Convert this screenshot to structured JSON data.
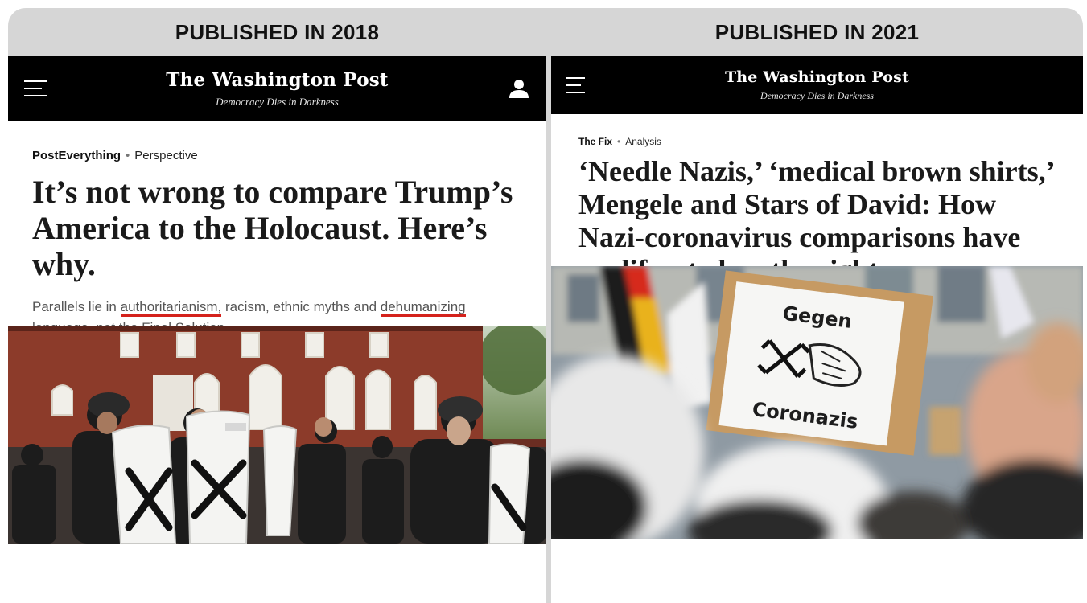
{
  "left": {
    "label": "PUBLISHED IN 2018",
    "masthead": "The Washington Post",
    "tagline": "Democracy Dies in Darkness",
    "section": "PostEverything",
    "category": "Perspective",
    "headline": "It’s not wrong to compare Trump’s America to the Holocaust. Here’s why.",
    "dek": {
      "pre": "Parallels lie in ",
      "u1": "authoritarianism,",
      "mid": " racism, ethnic myths and ",
      "u2": "dehumanizing language,",
      "post": " not the Final Solution"
    }
  },
  "right": {
    "label": "PUBLISHED IN 2021",
    "masthead": "The Washington Post",
    "tagline": "Democracy Dies in Darkness",
    "section": "The Fix",
    "category": "Analysis",
    "headline": "‘Needle Nazis,’ ‘medical brown shirts,’ Mengele and Stars of David: How Nazi-coronavirus comparisons have proliferated on the right",
    "sign_line1": "Gegen",
    "sign_line2": "Coronazis"
  },
  "colors": {
    "header_bg": "#000000",
    "label_bg": "#d6d6d6",
    "underline": "#d4221c"
  }
}
